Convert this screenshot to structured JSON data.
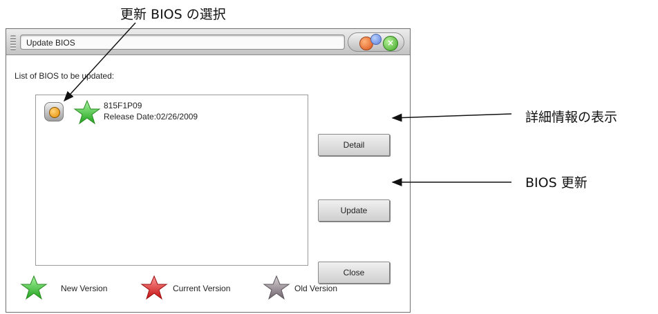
{
  "annotations": {
    "select_bios": "更新 BIOS の選択",
    "show_detail": "詳細情報の表示",
    "update_bios": "BIOS 更新"
  },
  "window": {
    "title": "Update BIOS",
    "controls": {
      "close_glyph": "×"
    }
  },
  "list": {
    "caption": "List of  BIOS to be updated:",
    "entries": [
      {
        "name": "815F1P09",
        "release_date": "Release Date:02/26/2009",
        "status": "new",
        "selected": true
      }
    ]
  },
  "buttons": {
    "detail": "Detail",
    "update": "Update",
    "close": "Close"
  },
  "legend": {
    "new": {
      "label": "New Version",
      "color": "#3cc43a"
    },
    "current": {
      "label": "Current Version",
      "color": "#e02020"
    },
    "old": {
      "label": "Old Version",
      "color": "#9a8f96"
    }
  },
  "colors": {
    "window_bg": "#d2d2d2",
    "accent_orange": "#e48a00"
  }
}
